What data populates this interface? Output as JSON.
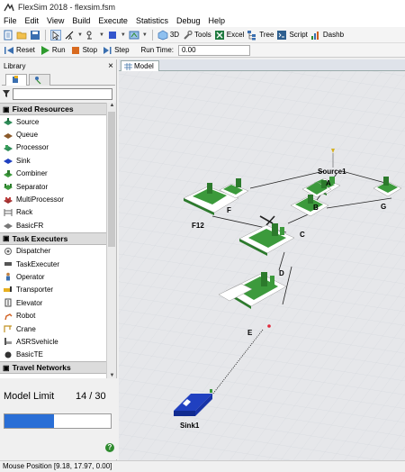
{
  "window": {
    "title": "FlexSim 2018 - flexsim.fsm"
  },
  "menu": [
    "File",
    "Edit",
    "View",
    "Build",
    "Execute",
    "Statistics",
    "Debug",
    "Help"
  ],
  "toolbar": {
    "view3d": "3D",
    "tools": "Tools",
    "excel": "Excel",
    "tree": "Tree",
    "script": "Script",
    "dashboards": "Dashb"
  },
  "run": {
    "reset": "Reset",
    "run": "Run",
    "stop": "Stop",
    "step": "Step",
    "run_time_label": "Run Time:",
    "run_time_value": "0.00"
  },
  "library": {
    "title": "Library",
    "close": "×",
    "search_value": "",
    "groups": [
      {
        "name": "Fixed Resources",
        "items": [
          "Source",
          "Queue",
          "Processor",
          "Sink",
          "Combiner",
          "Separator",
          "MultiProcessor",
          "Rack",
          "BasicFR"
        ]
      },
      {
        "name": "Task Executers",
        "items": [
          "Dispatcher",
          "TaskExecuter",
          "Operator",
          "Transporter",
          "Elevator",
          "Robot",
          "Crane",
          "ASRSvehicle",
          "BasicTE"
        ]
      },
      {
        "name": "Travel Networks",
        "items": []
      }
    ]
  },
  "model_limit": {
    "label": "Model Limit",
    "count": "14 / 30",
    "used": 14,
    "max": 30
  },
  "model_view": {
    "tab_label": "Model",
    "objects": [
      {
        "id": "source1",
        "label": "Source1"
      },
      {
        "id": "a",
        "label": "A"
      },
      {
        "id": "b",
        "label": "B"
      },
      {
        "id": "g",
        "label": "G"
      },
      {
        "id": "f",
        "label": "F"
      },
      {
        "id": "f12",
        "label": "F12"
      },
      {
        "id": "c",
        "label": "C"
      },
      {
        "id": "d",
        "label": "D"
      },
      {
        "id": "e",
        "label": "E"
      },
      {
        "id": "sink1",
        "label": "Sink1"
      }
    ]
  },
  "status": {
    "mouse_position": "Mouse Position [9.18, 17.97, 0.00]"
  },
  "colors": {
    "object_green": "#3c9a3c",
    "floor": "#e6e7ea",
    "progress_fill": "#2a6fd6",
    "sink_blue": "#2040c0"
  }
}
